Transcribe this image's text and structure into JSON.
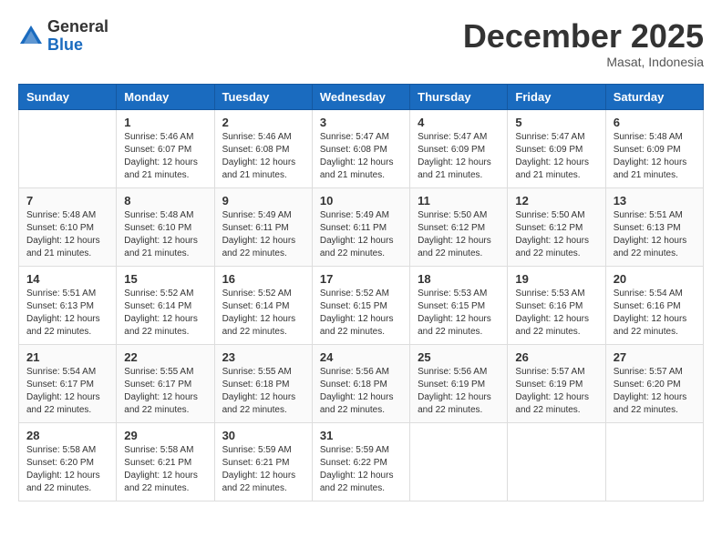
{
  "header": {
    "logo": {
      "general": "General",
      "blue": "Blue"
    },
    "title": "December 2025",
    "location": "Masat, Indonesia"
  },
  "columns": [
    "Sunday",
    "Monday",
    "Tuesday",
    "Wednesday",
    "Thursday",
    "Friday",
    "Saturday"
  ],
  "weeks": [
    [
      {
        "day": "",
        "info": ""
      },
      {
        "day": "1",
        "info": "Sunrise: 5:46 AM\nSunset: 6:07 PM\nDaylight: 12 hours\nand 21 minutes."
      },
      {
        "day": "2",
        "info": "Sunrise: 5:46 AM\nSunset: 6:08 PM\nDaylight: 12 hours\nand 21 minutes."
      },
      {
        "day": "3",
        "info": "Sunrise: 5:47 AM\nSunset: 6:08 PM\nDaylight: 12 hours\nand 21 minutes."
      },
      {
        "day": "4",
        "info": "Sunrise: 5:47 AM\nSunset: 6:09 PM\nDaylight: 12 hours\nand 21 minutes."
      },
      {
        "day": "5",
        "info": "Sunrise: 5:47 AM\nSunset: 6:09 PM\nDaylight: 12 hours\nand 21 minutes."
      },
      {
        "day": "6",
        "info": "Sunrise: 5:48 AM\nSunset: 6:09 PM\nDaylight: 12 hours\nand 21 minutes."
      }
    ],
    [
      {
        "day": "7",
        "info": "Sunrise: 5:48 AM\nSunset: 6:10 PM\nDaylight: 12 hours\nand 21 minutes."
      },
      {
        "day": "8",
        "info": "Sunrise: 5:48 AM\nSunset: 6:10 PM\nDaylight: 12 hours\nand 21 minutes."
      },
      {
        "day": "9",
        "info": "Sunrise: 5:49 AM\nSunset: 6:11 PM\nDaylight: 12 hours\nand 22 minutes."
      },
      {
        "day": "10",
        "info": "Sunrise: 5:49 AM\nSunset: 6:11 PM\nDaylight: 12 hours\nand 22 minutes."
      },
      {
        "day": "11",
        "info": "Sunrise: 5:50 AM\nSunset: 6:12 PM\nDaylight: 12 hours\nand 22 minutes."
      },
      {
        "day": "12",
        "info": "Sunrise: 5:50 AM\nSunset: 6:12 PM\nDaylight: 12 hours\nand 22 minutes."
      },
      {
        "day": "13",
        "info": "Sunrise: 5:51 AM\nSunset: 6:13 PM\nDaylight: 12 hours\nand 22 minutes."
      }
    ],
    [
      {
        "day": "14",
        "info": "Sunrise: 5:51 AM\nSunset: 6:13 PM\nDaylight: 12 hours\nand 22 minutes."
      },
      {
        "day": "15",
        "info": "Sunrise: 5:52 AM\nSunset: 6:14 PM\nDaylight: 12 hours\nand 22 minutes."
      },
      {
        "day": "16",
        "info": "Sunrise: 5:52 AM\nSunset: 6:14 PM\nDaylight: 12 hours\nand 22 minutes."
      },
      {
        "day": "17",
        "info": "Sunrise: 5:52 AM\nSunset: 6:15 PM\nDaylight: 12 hours\nand 22 minutes."
      },
      {
        "day": "18",
        "info": "Sunrise: 5:53 AM\nSunset: 6:15 PM\nDaylight: 12 hours\nand 22 minutes."
      },
      {
        "day": "19",
        "info": "Sunrise: 5:53 AM\nSunset: 6:16 PM\nDaylight: 12 hours\nand 22 minutes."
      },
      {
        "day": "20",
        "info": "Sunrise: 5:54 AM\nSunset: 6:16 PM\nDaylight: 12 hours\nand 22 minutes."
      }
    ],
    [
      {
        "day": "21",
        "info": "Sunrise: 5:54 AM\nSunset: 6:17 PM\nDaylight: 12 hours\nand 22 minutes."
      },
      {
        "day": "22",
        "info": "Sunrise: 5:55 AM\nSunset: 6:17 PM\nDaylight: 12 hours\nand 22 minutes."
      },
      {
        "day": "23",
        "info": "Sunrise: 5:55 AM\nSunset: 6:18 PM\nDaylight: 12 hours\nand 22 minutes."
      },
      {
        "day": "24",
        "info": "Sunrise: 5:56 AM\nSunset: 6:18 PM\nDaylight: 12 hours\nand 22 minutes."
      },
      {
        "day": "25",
        "info": "Sunrise: 5:56 AM\nSunset: 6:19 PM\nDaylight: 12 hours\nand 22 minutes."
      },
      {
        "day": "26",
        "info": "Sunrise: 5:57 AM\nSunset: 6:19 PM\nDaylight: 12 hours\nand 22 minutes."
      },
      {
        "day": "27",
        "info": "Sunrise: 5:57 AM\nSunset: 6:20 PM\nDaylight: 12 hours\nand 22 minutes."
      }
    ],
    [
      {
        "day": "28",
        "info": "Sunrise: 5:58 AM\nSunset: 6:20 PM\nDaylight: 12 hours\nand 22 minutes."
      },
      {
        "day": "29",
        "info": "Sunrise: 5:58 AM\nSunset: 6:21 PM\nDaylight: 12 hours\nand 22 minutes."
      },
      {
        "day": "30",
        "info": "Sunrise: 5:59 AM\nSunset: 6:21 PM\nDaylight: 12 hours\nand 22 minutes."
      },
      {
        "day": "31",
        "info": "Sunrise: 5:59 AM\nSunset: 6:22 PM\nDaylight: 12 hours\nand 22 minutes."
      },
      {
        "day": "",
        "info": ""
      },
      {
        "day": "",
        "info": ""
      },
      {
        "day": "",
        "info": ""
      }
    ]
  ]
}
